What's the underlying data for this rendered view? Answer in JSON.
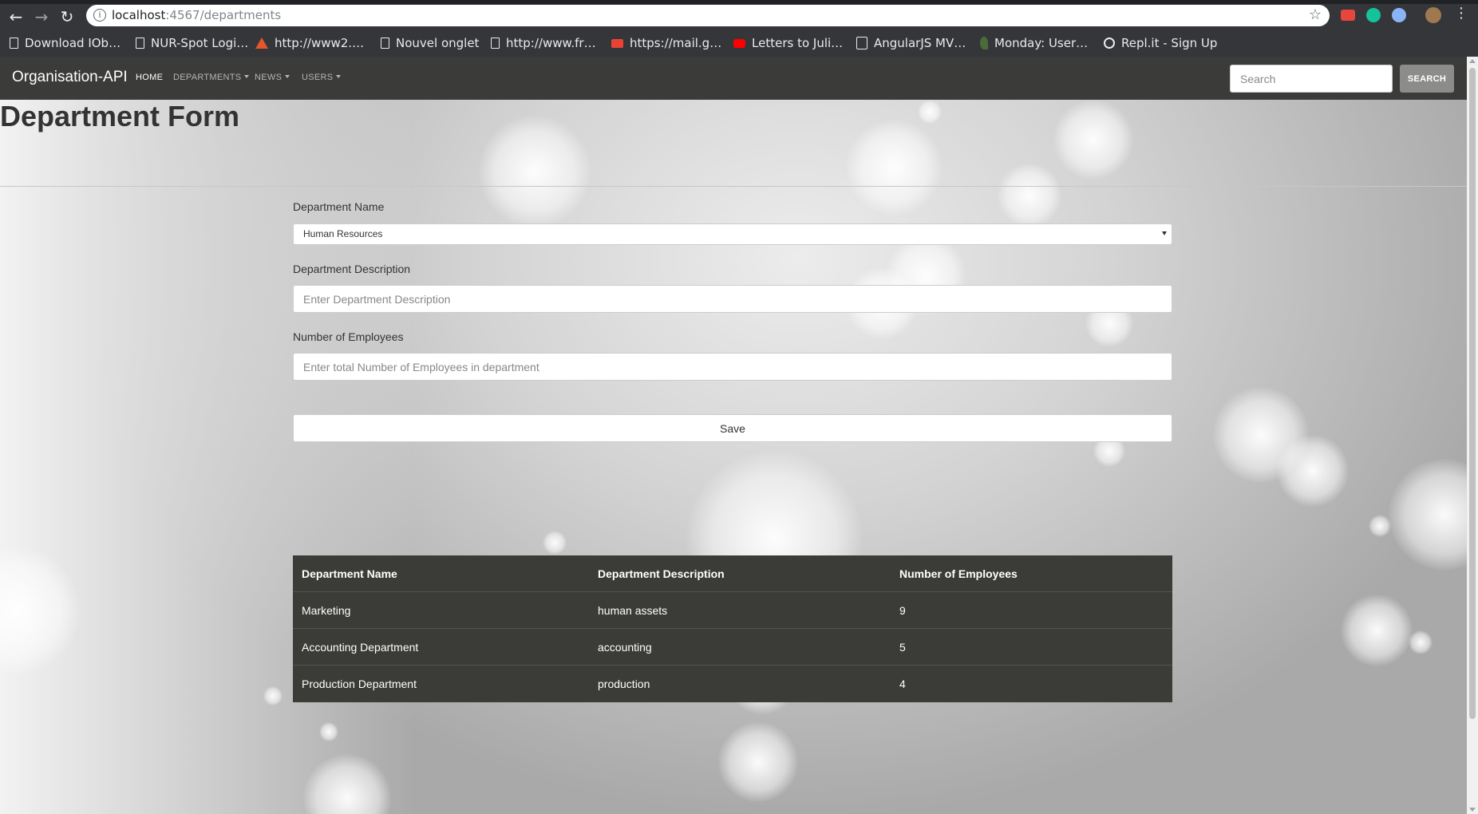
{
  "browser": {
    "url_host": "localhost",
    "url_rest": ":4567/departments",
    "bookmarks": [
      {
        "label": "Download IOb…",
        "icon": "document-icon"
      },
      {
        "label": "NUR-Spot Logi…",
        "icon": "document-icon"
      },
      {
        "label": "http://www2.…",
        "icon": "triangle-logo-icon"
      },
      {
        "label": "Nouvel onglet",
        "icon": "document-icon"
      },
      {
        "label": "http://www.fr…",
        "icon": "document-icon"
      },
      {
        "label": "https://mail.g…",
        "icon": "gmail-icon"
      },
      {
        "label": "Letters to Juli…",
        "icon": "youtube-icon"
      },
      {
        "label": "AngularJS MV…",
        "icon": "angular-icon"
      },
      {
        "label": "Monday: User…",
        "icon": "leaf-icon"
      },
      {
        "label": "Repl.it - Sign Up",
        "icon": "replit-icon"
      }
    ]
  },
  "navbar": {
    "brand": "Organisation-API",
    "links": [
      "HOME",
      "DEPARTMENTS",
      "NEWS",
      "USERS"
    ],
    "search_placeholder": "Search",
    "search_button": "SEARCH"
  },
  "page": {
    "title": "Department Form"
  },
  "form": {
    "name_label": "Department Name",
    "name_selected": "Human Resources",
    "description_label": "Department Description",
    "description_placeholder": "Enter Department Description",
    "employees_label": "Number of Employees",
    "employees_placeholder": "Enter total Number of Employees in department",
    "save_label": "Save"
  },
  "table": {
    "headers": [
      "Department Name",
      "Department Description",
      "Number of Employees"
    ],
    "rows": [
      [
        "Marketing",
        "human assets",
        "9"
      ],
      [
        "Accounting Department",
        "accounting",
        "5"
      ],
      [
        "Production Department",
        "production",
        "4"
      ]
    ]
  },
  "colors": {
    "navbar_bg": "#3b3b3a",
    "table_bg": "#3b3b38",
    "search_button_bg": "#8c8c8a"
  }
}
